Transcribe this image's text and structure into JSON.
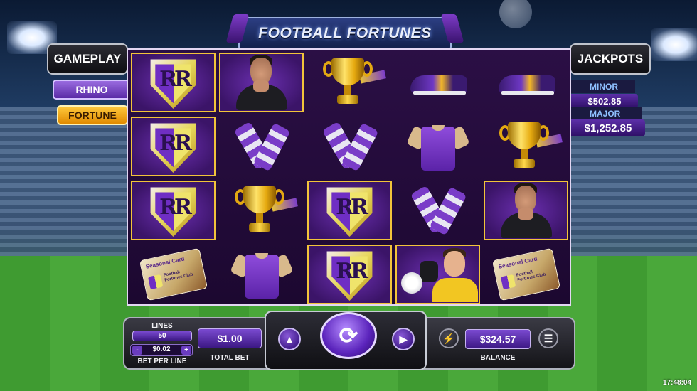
{
  "game": {
    "title": "FOOTBALL FORTUNES"
  },
  "left_panel": {
    "header": "GAMEPLAY",
    "modes": [
      {
        "label": "RHINO",
        "color": "#7a4ad0"
      },
      {
        "label": "FORTUNE",
        "color": "#f5a91a"
      }
    ]
  },
  "jackpots": {
    "header": "JACKPOTS",
    "minor": {
      "label": "MINOR",
      "value": "$502.85"
    },
    "major": {
      "label": "MAJOR",
      "value": "$1,252.85"
    }
  },
  "reels": {
    "rows": [
      [
        "shield",
        "referee",
        "trophy",
        "boot",
        "boot"
      ],
      [
        "shield",
        "scarf",
        "scarf",
        "jersey",
        "trophy"
      ],
      [
        "shield",
        "trophy",
        "shield",
        "scarf",
        "referee"
      ],
      [
        "season-card",
        "jersey",
        "shield",
        "goalkeeper",
        "season-card"
      ]
    ],
    "shield_text": "RR",
    "season_card": {
      "title": "Seasonal Card",
      "subtitle": "Football Fortunes Club"
    }
  },
  "controls": {
    "lines_label": "LINES",
    "lines_value": "50",
    "bet_per_line_value": "$0.02",
    "bet_per_line_label": "BET PER LINE",
    "minus": "-",
    "plus": "+",
    "total_bet_value": "$1.00",
    "total_bet_label": "TOTAL BET",
    "balance_value": "$324.57",
    "balance_label": "BALANCE"
  },
  "status": {
    "clock": "17:48:04"
  },
  "colors": {
    "accent_purple": "#5a23bb",
    "gold": "#f2c43a"
  }
}
